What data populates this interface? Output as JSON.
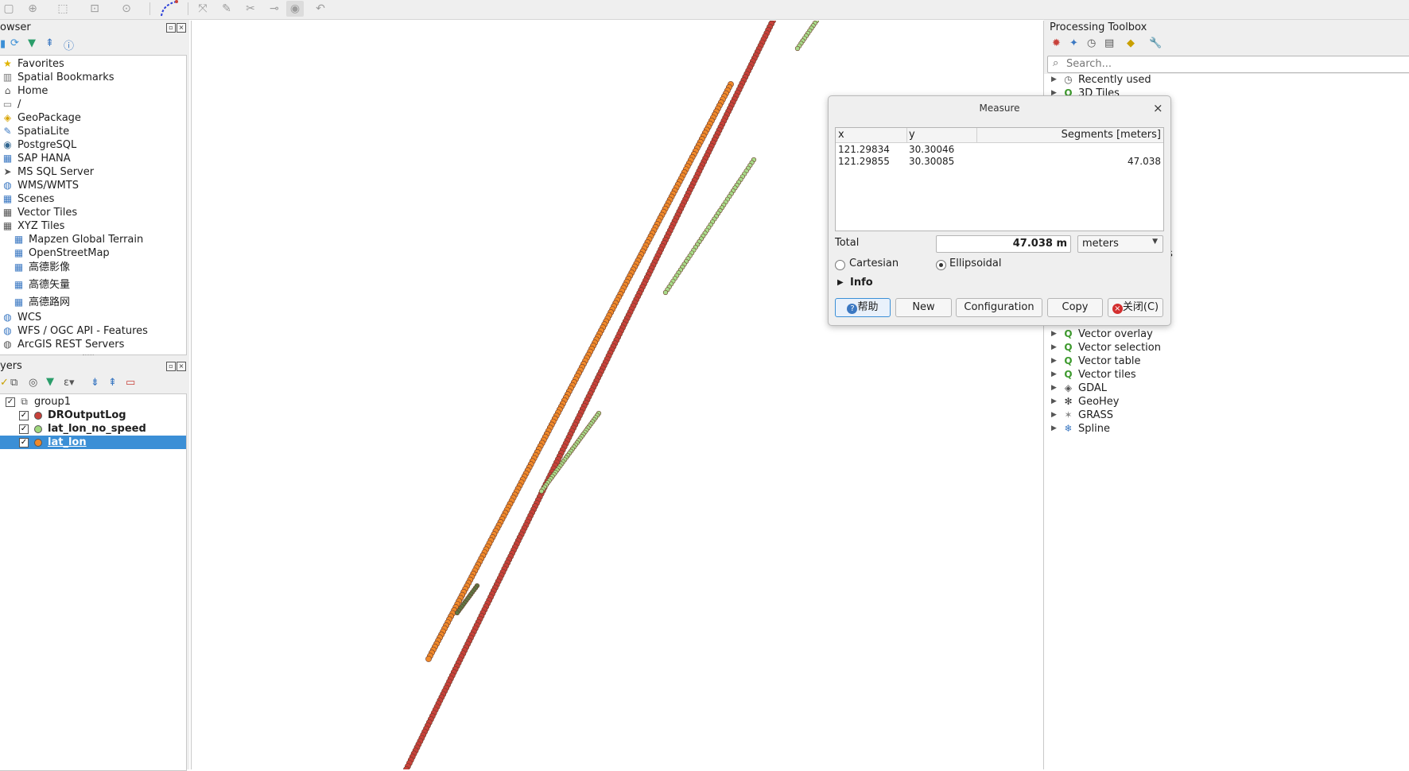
{
  "toolbar": {
    "icons": [
      "new-map-view-icon",
      "zoom-icon",
      "select-icon",
      "identify-icon",
      "pan-icon",
      "digitize-icon",
      "node-tool-icon",
      "vertex-edit-icon",
      "cut-icon",
      "link-icon",
      "visibility-icon",
      "undo-icon"
    ]
  },
  "browser": {
    "title": "owser",
    "items": [
      {
        "label": "Favorites",
        "icon": "star-icon"
      },
      {
        "label": "Spatial Bookmarks",
        "icon": "bookmark-icon"
      },
      {
        "label": "Home",
        "icon": "home-icon"
      },
      {
        "label": "/",
        "icon": "folder-icon"
      },
      {
        "label": "GeoPackage",
        "icon": "geopackage-icon"
      },
      {
        "label": "SpatiaLite",
        "icon": "spatialite-icon"
      },
      {
        "label": "PostgreSQL",
        "icon": "postgresql-icon"
      },
      {
        "label": "SAP HANA",
        "icon": "sap-hana-icon"
      },
      {
        "label": "MS SQL Server",
        "icon": "mssql-icon"
      },
      {
        "label": "WMS/WMTS",
        "icon": "wms-icon"
      },
      {
        "label": "Scenes",
        "icon": "scenes-icon"
      },
      {
        "label": "Vector Tiles",
        "icon": "vector-tiles-icon"
      },
      {
        "label": "XYZ Tiles",
        "icon": "xyz-tiles-icon"
      },
      {
        "label": "Mapzen Global Terrain",
        "icon": "tile-grid-icon"
      },
      {
        "label": "OpenStreetMap",
        "icon": "tile-grid-icon"
      },
      {
        "label": "高德影像",
        "icon": "tile-grid-icon"
      },
      {
        "label": "高德矢量",
        "icon": "tile-grid-icon"
      },
      {
        "label": "高德路网",
        "icon": "tile-grid-icon"
      },
      {
        "label": "WCS",
        "icon": "wcs-icon"
      },
      {
        "label": "WFS / OGC API - Features",
        "icon": "wfs-icon"
      },
      {
        "label": "ArcGIS REST Servers",
        "icon": "arcgis-icon"
      }
    ]
  },
  "layers": {
    "title": "yers",
    "group": "group1",
    "items": [
      {
        "label": "DROutputLog",
        "color": "#c8413a",
        "checked": true,
        "selected": false
      },
      {
        "label": "lat_lon_no_speed",
        "color": "#9fd77c",
        "checked": true,
        "selected": false
      },
      {
        "label": "lat_lon",
        "color": "#f0892a",
        "checked": true,
        "selected": true
      }
    ]
  },
  "toolbox": {
    "title": "Processing Toolbox",
    "search_placeholder": "Search...",
    "items_top": [
      {
        "label": "Recently used",
        "icon": "clock-icon"
      },
      {
        "label": "3D Tiles",
        "icon": "qgis-icon"
      }
    ],
    "items_bottom": [
      {
        "label": "Vector geometry",
        "icon": "qgis-icon"
      },
      {
        "label": "Vector overlay",
        "icon": "qgis-icon"
      },
      {
        "label": "Vector selection",
        "icon": "qgis-icon"
      },
      {
        "label": "Vector table",
        "icon": "qgis-icon"
      },
      {
        "label": "Vector tiles",
        "icon": "qgis-icon"
      },
      {
        "label": "GDAL",
        "icon": "gdal-icon"
      },
      {
        "label": "GeoHey",
        "icon": "geohey-icon"
      },
      {
        "label": "GRASS",
        "icon": "grass-icon"
      },
      {
        "label": "Spline",
        "icon": "spline-icon"
      }
    ],
    "partial_text": "ysis"
  },
  "measure": {
    "title": "Measure",
    "columns": {
      "x": "x",
      "y": "y",
      "segments": "Segments [meters]"
    },
    "rows": [
      {
        "x": "121.29834",
        "y": "30.30046",
        "seg": ""
      },
      {
        "x": "121.29855",
        "y": "30.30085",
        "seg": "47.038"
      }
    ],
    "total_label": "Total",
    "total_value": "47.038 m",
    "unit": "meters",
    "cartesian": "Cartesian",
    "ellipsoidal": "Ellipsoidal",
    "mode_selected": "Ellipsoidal",
    "info": "Info",
    "buttons": {
      "help": "帮助",
      "new": "New",
      "configuration": "Configuration",
      "copy": "Copy",
      "close": "关闭(C)"
    }
  },
  "colors": {
    "red_track": "#c8413a",
    "orange_track": "#f0892a",
    "green_track": "#a8dc8a",
    "selection": "#3b8fd6"
  }
}
